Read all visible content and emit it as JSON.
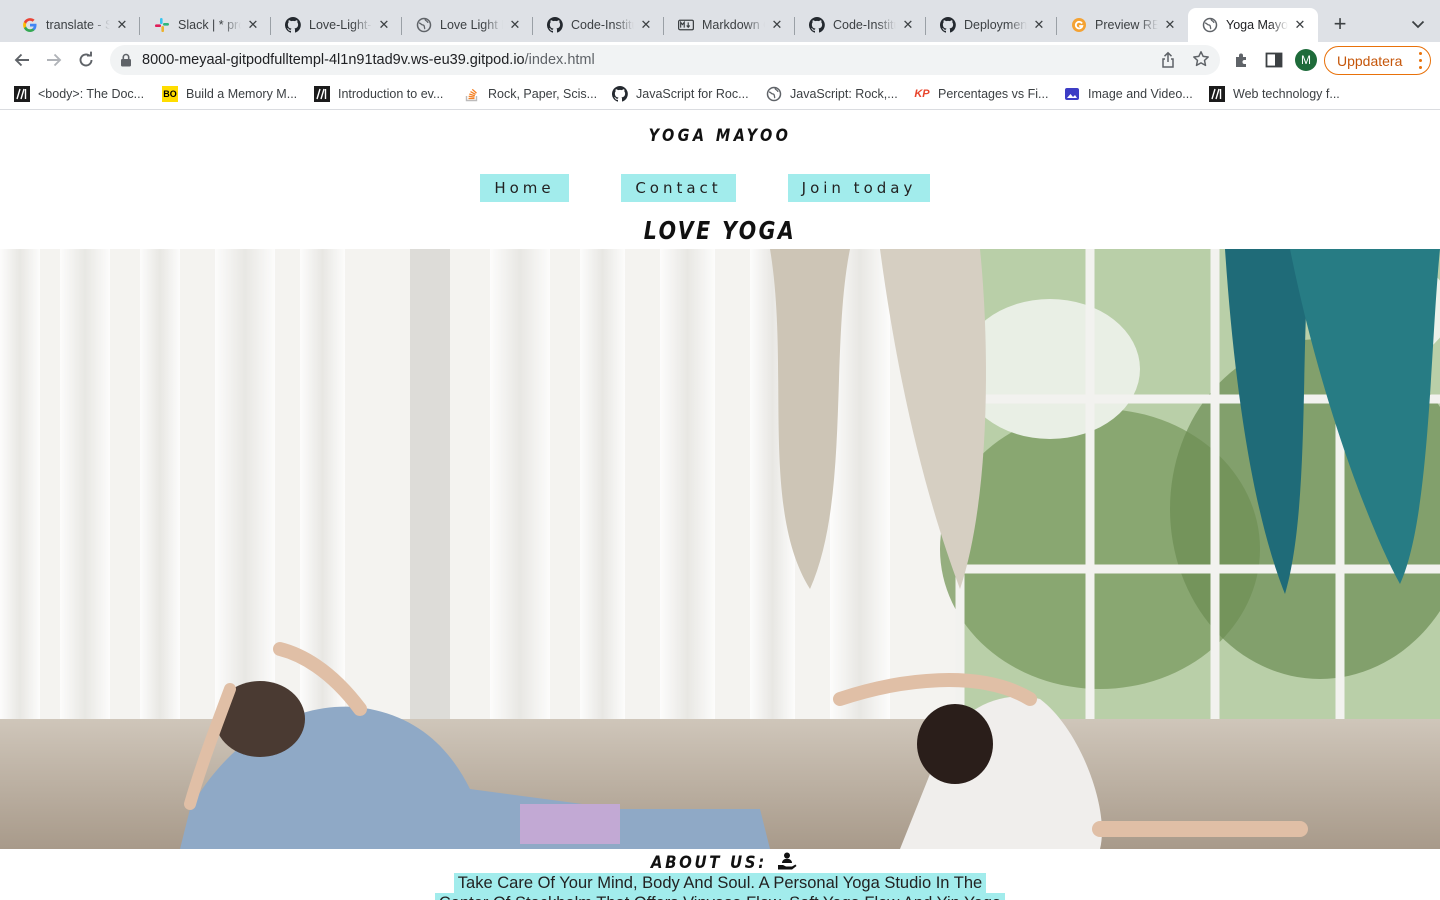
{
  "browser": {
    "tabs": [
      {
        "title": "translate - S",
        "icon": "google-g-icon"
      },
      {
        "title": "Slack | * pro",
        "icon": "slack-icon"
      },
      {
        "title": "Love-Light-",
        "icon": "github-icon"
      },
      {
        "title": "Love Light P",
        "icon": "globe-icon"
      },
      {
        "title": "Code-Institu",
        "icon": "github-icon"
      },
      {
        "title": "Markdown C",
        "icon": "markdown-icon"
      },
      {
        "title": "Code-Institu",
        "icon": "github-icon"
      },
      {
        "title": "Deployment",
        "icon": "github-icon"
      },
      {
        "title": "Preview REA",
        "icon": "preview-g-icon"
      },
      {
        "title": "Yoga Mayoo",
        "icon": "globe-icon",
        "active": true
      }
    ],
    "new_tab": "+",
    "url_host": "8000-meyaal-gitpodfulltempl-4l1n91tad9v.ws-eu39.gitpod.io",
    "url_path": "/index.html",
    "profile_initial": "M",
    "update_label": "Uppdatera",
    "accent_color": "#e8710a",
    "bookmarks": [
      {
        "title": "<body>: The Doc...",
        "icon": "mdn-icon"
      },
      {
        "title": "Build a Memory M...",
        "icon": "bo-icon"
      },
      {
        "title": "Introduction to ev...",
        "icon": "mdn-icon"
      },
      {
        "title": "Rock, Paper, Scis...",
        "icon": "stackoverflow-icon"
      },
      {
        "title": "JavaScript for Roc...",
        "icon": "github-icon"
      },
      {
        "title": "JavaScript: Rock,...",
        "icon": "globe-icon"
      },
      {
        "title": "Percentages vs Fi...",
        "icon": "kp-icon"
      },
      {
        "title": "Image and Video...",
        "icon": "image-video-icon"
      },
      {
        "title": "Web technology f...",
        "icon": "mdn-icon"
      }
    ]
  },
  "site": {
    "brand": "YOGA MAYOO",
    "nav": [
      {
        "label": "Home"
      },
      {
        "label": "Contact"
      },
      {
        "label": "Join today"
      }
    ],
    "hero_title": "LOVE YOGA",
    "about_title": "ABOUT US:",
    "about_icon": "hand-holding-person-icon",
    "about_text": "Take Care Of Your Mind, Body And Soul. A Personal Yoga Studio In The Center Of Stockholm That Offers Vinyasa Flow, Soft Yoga Flow And Yin Yoga Small",
    "accent_color": "#a2ecec"
  }
}
